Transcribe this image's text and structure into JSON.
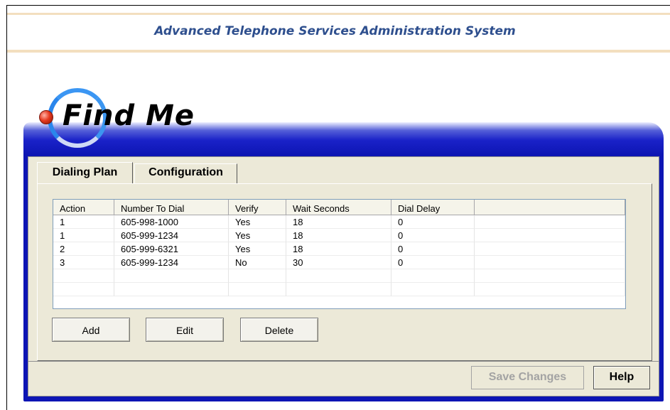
{
  "header": {
    "title": "Advanced Telephone Services Administration System"
  },
  "logo": {
    "text": "Find Me"
  },
  "tabs": [
    {
      "label": "Dialing Plan",
      "active": true
    },
    {
      "label": "Configuration",
      "active": false
    }
  ],
  "table": {
    "columns": [
      "Action",
      "Number To Dial",
      "Verify",
      "Wait Seconds",
      "Dial Delay",
      ""
    ],
    "rows": [
      [
        "1",
        "605-998-1000",
        "Yes",
        "18",
        "0",
        ""
      ],
      [
        "1",
        "605-999-1234",
        "Yes",
        "18",
        "0",
        ""
      ],
      [
        "2",
        "605-999-6321",
        "Yes",
        "18",
        "0",
        ""
      ],
      [
        "3",
        "605-999-1234",
        "No",
        "30",
        "0",
        ""
      ],
      [
        "",
        "",
        "",
        "",
        "",
        ""
      ],
      [
        "",
        "",
        "",
        "",
        "",
        ""
      ]
    ]
  },
  "actions": {
    "add_label": "Add",
    "edit_label": "Edit",
    "delete_label": "Delete"
  },
  "footer": {
    "save_label": "Save Changes",
    "help_label": "Help"
  },
  "colors": {
    "title": "#2e4f8e",
    "banner_blue": "#0d15b4",
    "panel_gray": "#ece9d8",
    "accent_rule": "#f3dfbf"
  }
}
